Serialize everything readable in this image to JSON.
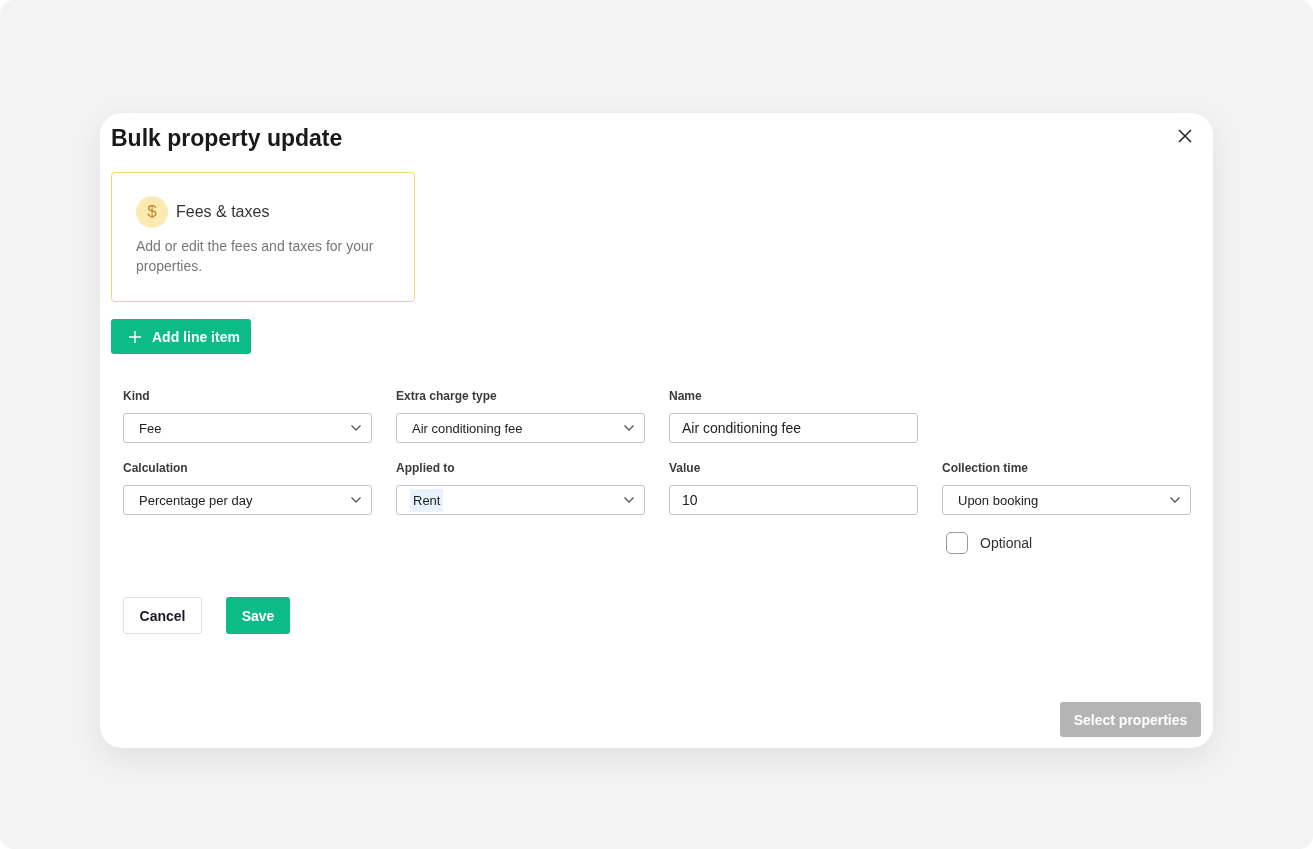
{
  "dialog": {
    "title": "Bulk property update"
  },
  "category_card": {
    "icon": "$",
    "title": "Fees & taxes",
    "description": "Add or edit the fees and taxes for your properties.",
    "selected": true
  },
  "add_button": {
    "label": "Add line item"
  },
  "form": {
    "rows": [
      [
        {
          "kind": "select",
          "label": "Kind",
          "value": "Fee"
        },
        {
          "kind": "select",
          "label": "Extra charge type",
          "value": "Air conditioning fee"
        },
        {
          "kind": "text",
          "label": "Name",
          "value": "Air conditioning fee"
        }
      ],
      [
        {
          "kind": "select",
          "label": "Calculation",
          "value": "Percentage per day"
        },
        {
          "kind": "multiselect",
          "label": "Applied to",
          "values": [
            "Rent"
          ]
        },
        {
          "kind": "text",
          "label": "Value",
          "value": "10"
        },
        {
          "kind": "select",
          "label": "Collection time",
          "value": "Upon booking"
        }
      ]
    ],
    "optional": {
      "label": "Optional",
      "checked": false
    }
  },
  "actions": {
    "cancel": "Cancel",
    "save": "Save"
  },
  "footer": {
    "select_properties": {
      "label": "Select properties",
      "disabled": true
    }
  }
}
